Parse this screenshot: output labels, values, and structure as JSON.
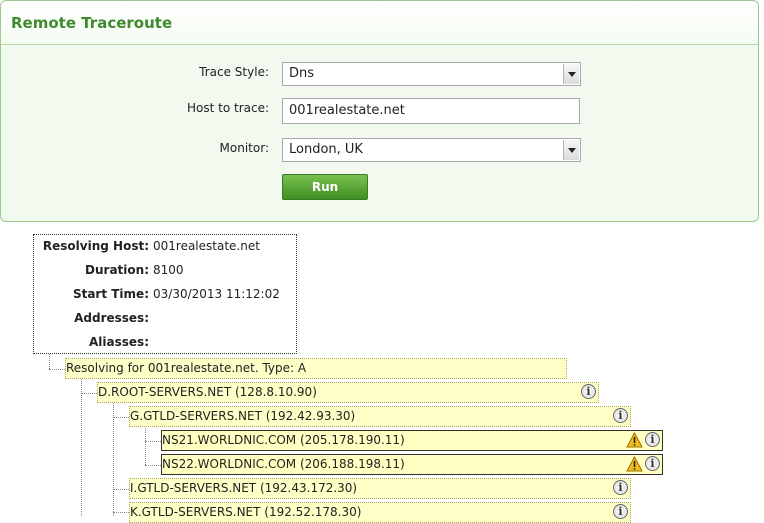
{
  "panel": {
    "title": "Remote Traceroute",
    "trace_style_label": "Trace Style:",
    "trace_style_value": "Dns",
    "host_label": "Host to trace:",
    "host_value": "001realestate.net",
    "monitor_label": "Monitor:",
    "monitor_value": "London, UK",
    "run_label": "Run"
  },
  "info": {
    "resolving_host_label": "Resolving Host:",
    "resolving_host_value": "001realestate.net",
    "duration_label": "Duration:",
    "duration_value": "8100",
    "start_time_label": "Start Time:",
    "start_time_value": "03/30/2013 11:12:02",
    "addresses_label": "Addresses:",
    "addresses_value": "",
    "aliases_label": "Aliasses:",
    "aliases_value": ""
  },
  "tree": {
    "root": "Resolving for 001realestate.net. Type: A",
    "nodes": [
      "D.ROOT-SERVERS.NET (128.8.10.90)",
      "G.GTLD-SERVERS.NET (192.42.93.30)",
      "NS21.WORLDNIC.COM (205.178.190.11)",
      "NS22.WORLDNIC.COM (206.188.198.11)",
      "I.GTLD-SERVERS.NET (192.43.172.30)",
      "K.GTLD-SERVERS.NET (192.52.178.30)"
    ],
    "info_glyph": "i",
    "warning_glyph": "!"
  },
  "colors": {
    "accent": "#3f8a2e",
    "node_bg": "#ffffc8",
    "warning": "#f0b400"
  }
}
